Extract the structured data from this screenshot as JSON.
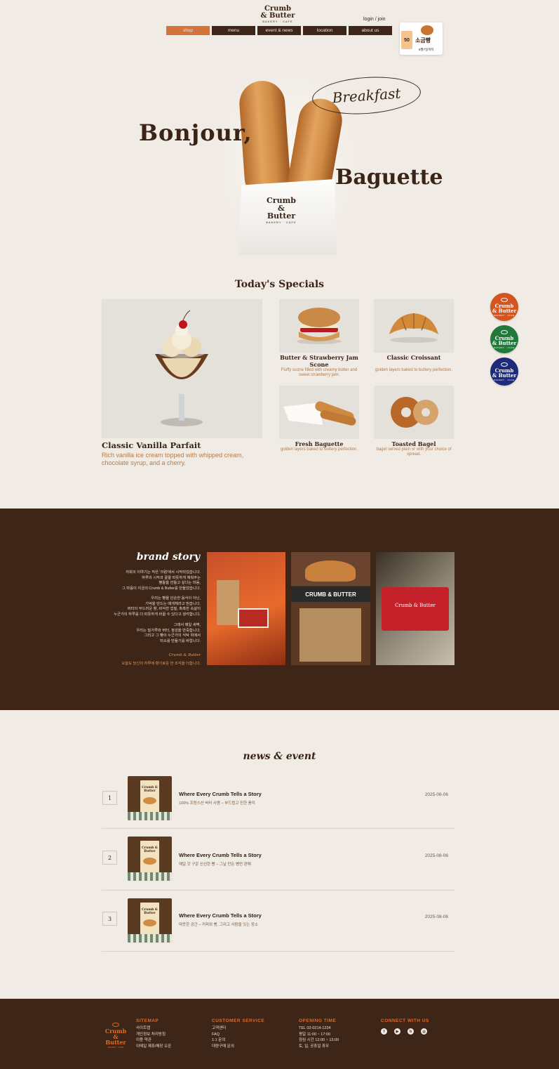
{
  "header": {
    "logo_line1": "Crumb",
    "logo_line2": "& Butter",
    "logo_sub": "BAKERY · CAFE",
    "login": "login / join",
    "nav": [
      "shop",
      "menu",
      "event & news",
      "location",
      "about us"
    ],
    "promo": {
      "percent": "50",
      "name": "소금빵",
      "date": "8월7일까지"
    }
  },
  "hero": {
    "headline1": "Bonjour,",
    "headline2": "Baguette",
    "tag": "Breakfast",
    "bag_logo1": "Crumb",
    "bag_logo2": "& Butter",
    "bag_sub": "BAKERY · CAFE"
  },
  "specials": {
    "title": "Today's Specials",
    "featured": {
      "name": "Classic Vanilla Parfait",
      "desc": "Rich vanilla ice cream topped with whipped cream, chocolate syrup, and a cherry."
    },
    "items": [
      {
        "name": "Butter & Strawberry Jam Scone",
        "desc": "Fluffy scone filled with creamy butter and sweet strawberry jam."
      },
      {
        "name": "Classic Croissant",
        "desc": "golden layers baked to buttery perfection."
      },
      {
        "name": "Fresh Baguette",
        "desc": "golden layers baked to buttery perfection."
      },
      {
        "name": "Toasted Bagel",
        "desc": "bagel served plain or with your choice of spread."
      }
    ]
  },
  "badges": [
    {
      "text1": "Crumb",
      "text2": "& Butter",
      "sub": "BAKERY · CAFE",
      "color": "#d4541f"
    },
    {
      "text1": "Crumb",
      "text2": "& Butter",
      "sub": "BAKERY · CAFE",
      "color": "#1f7a3a"
    },
    {
      "text1": "Crumb",
      "text2": "& Butter",
      "sub": "BAKERY · CAFE",
      "color": "#1e2a7a"
    }
  ],
  "brand": {
    "title": "brand story",
    "p1": [
      "저희의 이야기는 작은 '크럼'에서 시작되었습니다.",
      "하루의 시작과 끝을 따뜻하게 채워주는",
      "빵들을 만들고 싶다는 마음,",
      "그 마음이 지금의 Crumb & Butter를 만들었습니다."
    ],
    "p2": [
      "우리는 빵을 단순한 음식이 아닌,",
      "기억을 만드는 매개체라고 믿습니다.",
      "버터의 부드러운 향, 바삭한 껍질, 촉촉한 속살이",
      "누군가의 하루를 더 따뜻하게 바꿀 수 있다고 생각합니다."
    ],
    "p3": [
      "그래서 매일 새벽,",
      "우리는 밀가루와 버터, 정성을 반죽합니다.",
      "그리고 그 빵이 누군가의 식탁 위에서",
      "미소를 만들기를 바랍니다."
    ],
    "sign": "Crumb & Butter",
    "foot": "오늘도 당신의 하루에 향기로운 한 조각을 더합니다.",
    "photo2_sign": "CRUMB & BUTTER",
    "photo3_sign": "Crumb & Butter"
  },
  "news": {
    "title": "news & event",
    "items": [
      {
        "num": "1",
        "title": "Where Every Crumb Tells a Story",
        "desc": "100% 프랑스산 버터 사용 – 부드럽고 진한 풍미",
        "date": "2025-08-06",
        "thumb": "Crumb & Butter"
      },
      {
        "num": "2",
        "title": "Where Every Crumb Tells a Story",
        "desc": "매일 갓 구운 신선한 빵 – 그날 만든 빵만 판매",
        "date": "2025-08-06",
        "thumb": "Crumb & Butter"
      },
      {
        "num": "3",
        "title": "Where Every Crumb Tells a Story",
        "desc": "따뜻한 공간 – 커피와 빵, 그리고 사람을 잇는 장소",
        "date": "2025-08-06",
        "thumb": "Crumb & Butter"
      }
    ]
  },
  "footer": {
    "logo1": "Crumb",
    "logo2": "& Butter",
    "logo_sub": "BAKERY · CAFE",
    "sitemap": {
      "title": "SITEMAP",
      "items": [
        "사이트맵",
        "개인정보 처리방침",
        "이용 약관",
        "이메일 제휴/매장 오픈"
      ]
    },
    "service": {
      "title": "CUSTOMER SERVICE",
      "items": [
        "고객센터",
        "FAQ",
        "1:1 문의",
        "대량구매 문의"
      ]
    },
    "hours": {
      "title": "OPENING TIME",
      "items": [
        "TEL 02-0214-1234",
        "평일 11:00 ~ 17:00",
        "점심 시간 12:00 ~ 13:00",
        "토, 일, 공휴일 휴무"
      ]
    },
    "connect": {
      "title": "CONNECT WITH US",
      "icons": [
        "facebook-icon",
        "youtube-icon",
        "blog-icon",
        "instagram-icon"
      ]
    }
  }
}
